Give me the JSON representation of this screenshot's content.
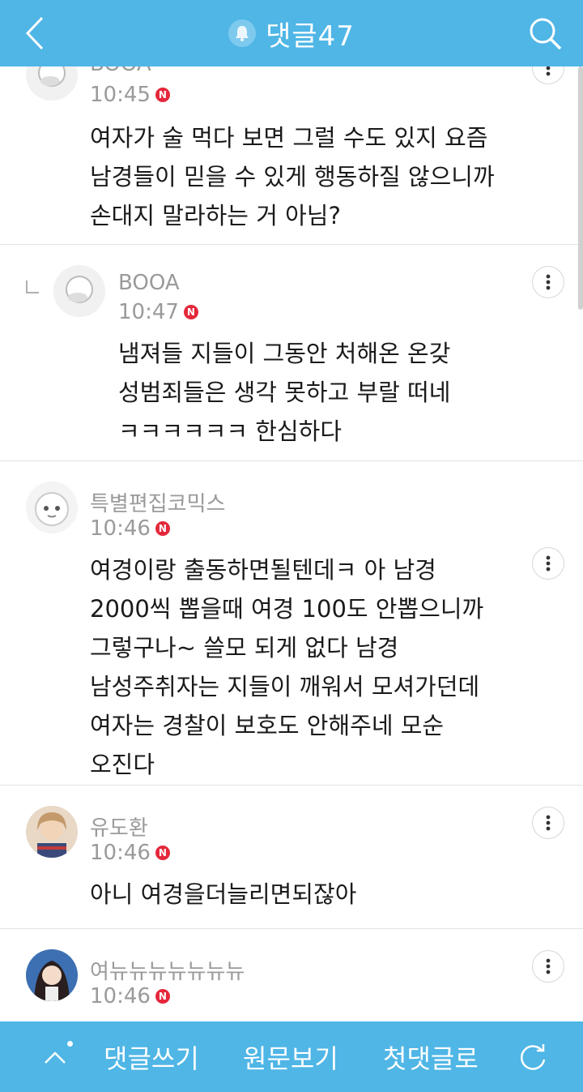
{
  "header": {
    "title": "댓글47"
  },
  "comments": [
    {
      "name": "BOOA",
      "time": "10:45",
      "text": "여자가 술 먹다 보면 그럴 수도 있지 요즘\n남경들이 믿을 수 있게 행동하질 않으니까\n손대지 말라하는 거 아님?"
    },
    {
      "name": "BOOA",
      "time": "10:47",
      "text": "냄져들 지들이 그동안 처해온 온갖\n성범죄들은 생각 못하고 부랄 떠네\nㅋㅋㅋㅋㅋㅋ 한심하다"
    },
    {
      "name": "특별편집코믹스",
      "time": "10:46",
      "text": "여경이랑 출동하면될텐데ㅋ 아 남경\n2000씩 뽑을때 여경 100도 안뽑으니까\n그렇구나~ 쓸모 되게 없다 남경\n남성주취자는 지들이 깨워서 모셔가던데\n여자는 경찰이 보호도 안해주네 모순\n오진다"
    },
    {
      "name": "유도환",
      "time": "10:46",
      "text": "아니 여경을더늘리면되잖아"
    },
    {
      "name": "여뉴뉴뉴뉴뉴뉴뉴",
      "time": "10:46",
      "text": ""
    }
  ],
  "bottom": {
    "write": "댓글쓰기",
    "original": "원문보기",
    "first": "첫댓글로"
  },
  "colors": {
    "accent": "#4fb6e6",
    "badge": "#e5273b"
  },
  "icons": {
    "back": "chevron-left",
    "bell": "bell",
    "search": "magnifier",
    "more": "vertical-dots",
    "up": "chevron-up",
    "refresh": "refresh"
  }
}
